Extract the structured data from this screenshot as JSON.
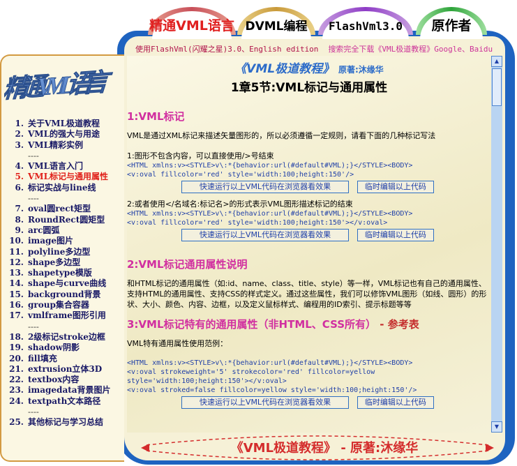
{
  "tabs": [
    {
      "label": "精通VML语言",
      "active": true
    },
    {
      "label": "DVML编程"
    },
    {
      "label": "FlashVml3.0"
    },
    {
      "label": "原作者"
    }
  ],
  "header": {
    "left": "使用FlashVml(闪耀之星)3.0、English edition",
    "right": "搜索完全下载《VML极道教程》Google、Baidu"
  },
  "logo_text": "精通VML语言",
  "nav": [
    {
      "num": "1.",
      "label": "关于VML极道教程"
    },
    {
      "num": "2.",
      "label": "VML的强大与用途"
    },
    {
      "num": "3.",
      "label": "VML精彩实例"
    },
    {
      "sep": "----"
    },
    {
      "num": "4.",
      "label": "VML语言入门"
    },
    {
      "num": "5.",
      "label": "VML标记与通用属性",
      "active": true
    },
    {
      "num": "6.",
      "label": "标记实战与line线"
    },
    {
      "sep": "----"
    },
    {
      "num": "7.",
      "label": "oval圆rect矩型"
    },
    {
      "num": "8.",
      "label": "RoundRect圆矩型"
    },
    {
      "num": "9.",
      "label": "arc圆弧"
    },
    {
      "num": "10.",
      "label": "image图片"
    },
    {
      "num": "11.",
      "label": "polyline多边型"
    },
    {
      "num": "12.",
      "label": "shape多边型"
    },
    {
      "num": "13.",
      "label": "shapetype模版"
    },
    {
      "num": "14.",
      "label": "shape与curve曲线"
    },
    {
      "num": "15.",
      "label": "background背景"
    },
    {
      "num": "16.",
      "label": "group集合容器"
    },
    {
      "num": "17.",
      "label": "vmlframe图形引用"
    },
    {
      "sep": "----"
    },
    {
      "num": "18.",
      "label": "2级标记stroke边框"
    },
    {
      "num": "19.",
      "label": "shadow阴影"
    },
    {
      "num": "20.",
      "label": "fill填充"
    },
    {
      "num": "21.",
      "label": "extrusion立体3D"
    },
    {
      "num": "22.",
      "label": "textbox内容"
    },
    {
      "num": "23.",
      "label": "imagedata背景图片"
    },
    {
      "num": "24.",
      "label": "textpath文本路径"
    },
    {
      "sep": "----"
    },
    {
      "num": "25.",
      "label": "其他标记与学习总结"
    }
  ],
  "content": {
    "book_title": "《VML极道教程》",
    "author": "原著:沐缘华",
    "chapter_title": "1章5节:VML标记与通用属性",
    "sec1": {
      "heading": "1:VML标记",
      "intro": "VML是通过XML标记来描述矢量图形的，所以必须遵循一定规则，请看下面的几种标记写法",
      "ex1_text": "1:图形不包含内容，可以直接使用/>号结束",
      "ex1_code1": "<HTML xmlns:v><STYLE>v\\:*{behavior:url(#default#VML);}</STYLE><BODY>",
      "ex1_code2": "<v:oval fillcolor='red' style='width:100;height:150'/>",
      "ex2_text": "2:或者使用</名域名:标记名>的形式表示VML图形描述标记的结束",
      "ex2_code1": "<HTML xmlns:v><STYLE>v\\:*{behavior:url(#default#VML);}</STYLE><BODY>",
      "ex2_code2": "<v:oval fillcolor='red' style='width:100;height:150'></v:oval>"
    },
    "sec2": {
      "heading": "2:VML标记通用属性说明",
      "text": "和HTML标记的通用属性（如:id、name、class、title、style）等一样，VML标记也有自己的通用属性、支持HTML的通用属性、支持CSS的样式定义。通过这些属性，我们可以修饰VML图形（如线、圆形）的形状、大小、颜色、内容、边框，以及定义鼠标样式、编程用的ID索引、提示标题等等"
    },
    "sec3": {
      "heading": "3:VML标记特有的通用属性（非HTML、CSS所有）",
      "dash": " - ",
      "link": "参考表",
      "intro": "VML特有通用属性使用范例：",
      "code1": "<HTML xmlns:v><STYLE>v\\:*{behavior:url(#default#VML);}</STYLE><BODY>",
      "code2": "<v:oval strokeweight='5' strokecolor='red' fillcolor=yellow",
      "code3": "style='width:100;height:150'></v:oval>",
      "code4": "<v:oval stroked=false fillcolor=yellow style='width:100;height:150'/>"
    },
    "run_button": "快速运行以上VML代码在浏览器看效果",
    "edit_button": "临时编辑以上代码"
  },
  "footer": "《VML极道教程》 - 原著:沐缘华",
  "colors": {
    "frame": "#1e63c0",
    "active_tab": "#e02020",
    "heading": "#d12fa0",
    "code": "#1f3fa8"
  }
}
